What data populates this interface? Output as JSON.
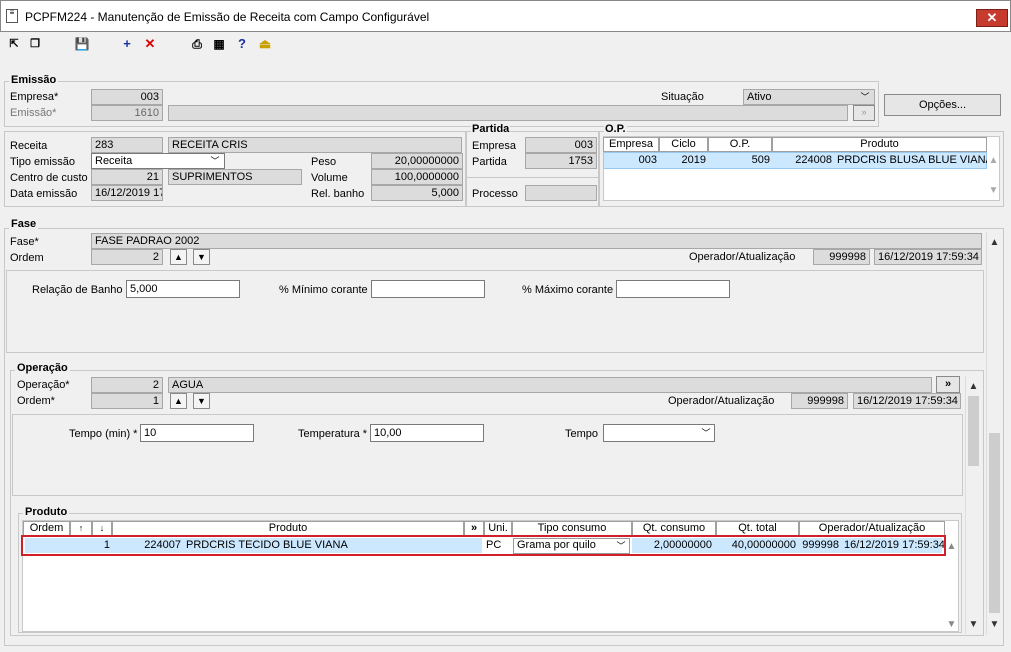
{
  "window": {
    "title": "PCPFM224 - Manutenção de Emissão de Receita com Campo Configurável",
    "close": "✕"
  },
  "emissao": {
    "header": "Emissão",
    "empresa_label": "Empresa*",
    "empresa": "003",
    "emissao_label": "Emissão*",
    "emissao": "1610",
    "situacao_label": "Situação",
    "situacao": "Ativo",
    "opcoes": "Opções..."
  },
  "receita": {
    "receita_label": "Receita",
    "receita_code": "283",
    "receita_name": "RECEITA CRIS",
    "tipo_label": "Tipo emissão",
    "tipo": "Receita",
    "centro_label": "Centro de custo",
    "centro_code": "21",
    "centro_name": "SUPRIMENTOS",
    "data_label": "Data emissão",
    "data": "16/12/2019 17",
    "peso_label": "Peso",
    "peso": "20,00000000",
    "volume_label": "Volume",
    "volume": "100,0000000",
    "relbanho_label": "Rel. banho",
    "relbanho": "5,000"
  },
  "partida": {
    "header": "Partida",
    "empresa_label": "Empresa",
    "empresa": "003",
    "partida_label": "Partida",
    "partida": "1753",
    "processo_label": "Processo",
    "processo": ""
  },
  "op": {
    "header": "O.P.",
    "columns": [
      "Empresa",
      "Ciclo",
      "O.P.",
      "Produto"
    ],
    "row": {
      "empresa": "003",
      "ciclo": "2019",
      "op": "509",
      "produto_code": "224008",
      "produto_name": "PRDCRIS BLUSA BLUE VIANA"
    }
  },
  "fase": {
    "header": "Fase",
    "fase_label": "Fase*",
    "fase": "FASE PADRAO 2002",
    "ordem_label": "Ordem",
    "ordem": "2",
    "oper_label": "Operador/Atualização",
    "oper_code": "999998",
    "oper_date": "16/12/2019 17:59:34",
    "rel_label": "Relação de Banho",
    "rel": "5,000",
    "min_label": "% Mínimo corante",
    "min": "",
    "max_label": "% Máximo corante",
    "max": ""
  },
  "operacao": {
    "header": "Operação",
    "op_label": "Operação*",
    "op_code": "2",
    "op_name": "AGUA",
    "ordem_label": "Ordem*",
    "ordem": "1",
    "oper_label": "Operador/Atualização",
    "oper_code": "999998",
    "oper_date": "16/12/2019 17:59:34",
    "tempo_min_label": "Tempo (min) *",
    "tempo_min": "10",
    "temp_label": "Temperatura *",
    "temp": "10,00",
    "tempo_label": "Tempo",
    "tempo": ""
  },
  "produto": {
    "header": "Produto",
    "columns": [
      "Ordem",
      "↑",
      "↓",
      "Produto",
      "»",
      "Uni.",
      "Tipo consumo",
      "Qt. consumo",
      "Qt. total",
      "Operador/Atualização"
    ],
    "row": {
      "ordem": "1",
      "code": "224007",
      "name": "PRDCRIS TECIDO BLUE VIANA",
      "uni": "PC",
      "tipo": "Grama por quilo",
      "qt_consumo": "2,00000000",
      "qt_total": "40,00000000",
      "oper_code": "999998",
      "oper_date": "16/12/2019 17:59:34"
    }
  },
  "symbols": {
    "up": "▲",
    "down": "▼",
    "chev": "﹀",
    "dbl": "»"
  }
}
